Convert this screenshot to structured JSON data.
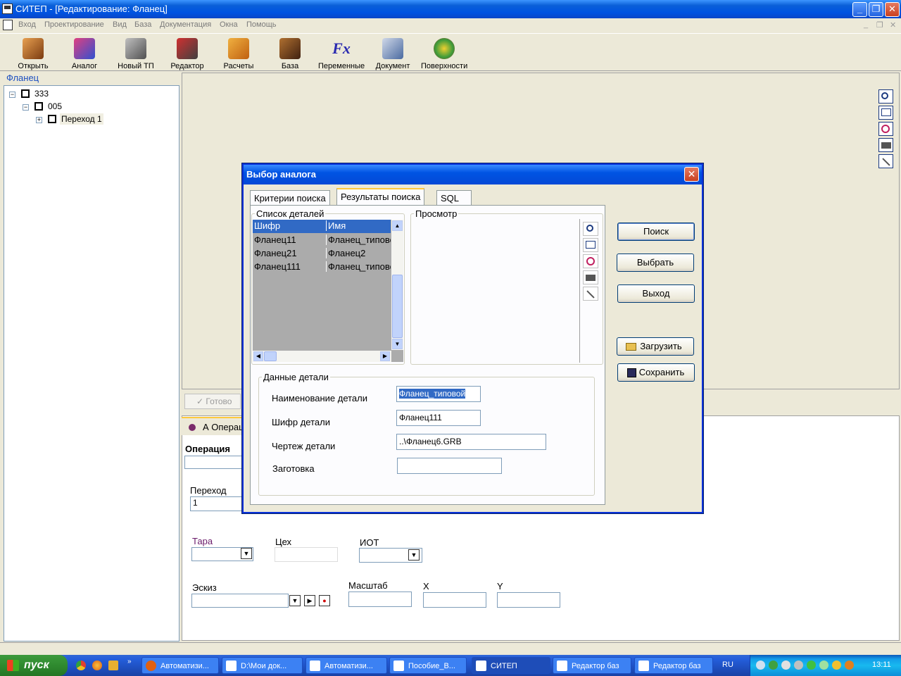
{
  "window": {
    "title": "СИТЕП - [Редактирование: Фланец]"
  },
  "menu": [
    "Вход",
    "Проектирование",
    "Вид",
    "База",
    "Документация",
    "Окна",
    "Помощь"
  ],
  "toolbar": [
    {
      "label": "Открыть",
      "icon": "open-icon",
      "color": "#b86b2a"
    },
    {
      "label": "Аналог",
      "icon": "analog-icon",
      "color": "#c03a9a"
    },
    {
      "label": "Новый ТП",
      "icon": "compass-icon",
      "color": "#707070"
    },
    {
      "label": "Редактор",
      "icon": "editor-icon",
      "color": "#c02020"
    },
    {
      "label": "Расчеты",
      "icon": "calculator-icon",
      "color": "#e08a20"
    },
    {
      "label": "База",
      "icon": "database-icon",
      "color": "#7a4a20"
    },
    {
      "label": "Переменные",
      "icon": "fx-icon",
      "color": "#2a2ab0"
    },
    {
      "label": "Документ",
      "icon": "document-icon",
      "color": "#4a6aa0"
    },
    {
      "label": "Поверхности",
      "icon": "surfaces-icon",
      "color": "#3a9a3a"
    }
  ],
  "left": {
    "label": "Фланец",
    "tree": [
      "333",
      "005",
      "Переход 1"
    ]
  },
  "bottom": {
    "ready": "Готово",
    "tab": "А Операц",
    "operation": "Операция",
    "transition": "Переход",
    "transition_value": "1",
    "tara": "Тара",
    "ceh": "Цех",
    "iot": "ИОТ",
    "sketch": "Эскиз",
    "scale": "Масштаб",
    "x": "X",
    "y": "Y"
  },
  "dialog": {
    "title": "Выбор аналога",
    "tabs": [
      "Критерии поиска",
      "Результаты поиска",
      "SQL"
    ],
    "list_group": "Список деталей",
    "preview_group": "Просмотр",
    "columns": [
      "Шифр",
      "Имя"
    ],
    "rows": [
      [
        "Фланец11",
        "Фланец_типовой"
      ],
      [
        "Фланец21",
        "Фланец2"
      ],
      [
        "Фланец111",
        "Фланец_типовой"
      ]
    ],
    "details_group": "Данные детали",
    "fields": [
      {
        "label": "Наименование детали",
        "value": "Фланец_типовой"
      },
      {
        "label": "Шифр детали",
        "value": "Фланец111"
      },
      {
        "label": "Чертеж детали",
        "value": "..\\Фланец6.GRB"
      },
      {
        "label": "Заготовка",
        "value": ""
      }
    ],
    "buttons": {
      "search": "Поиск",
      "select": "Выбрать",
      "exit": "Выход",
      "load": "Загрузить",
      "save": "Сохранить"
    }
  },
  "taskbar": {
    "start": "пуск",
    "tasks": [
      "Автоматизи...",
      "D:\\Мои док...",
      "Автоматизи...",
      "Пособие_В...",
      "СИТЕП",
      "Редактор баз",
      "Редактор баз"
    ],
    "lang": "RU",
    "clock": "13:11"
  }
}
